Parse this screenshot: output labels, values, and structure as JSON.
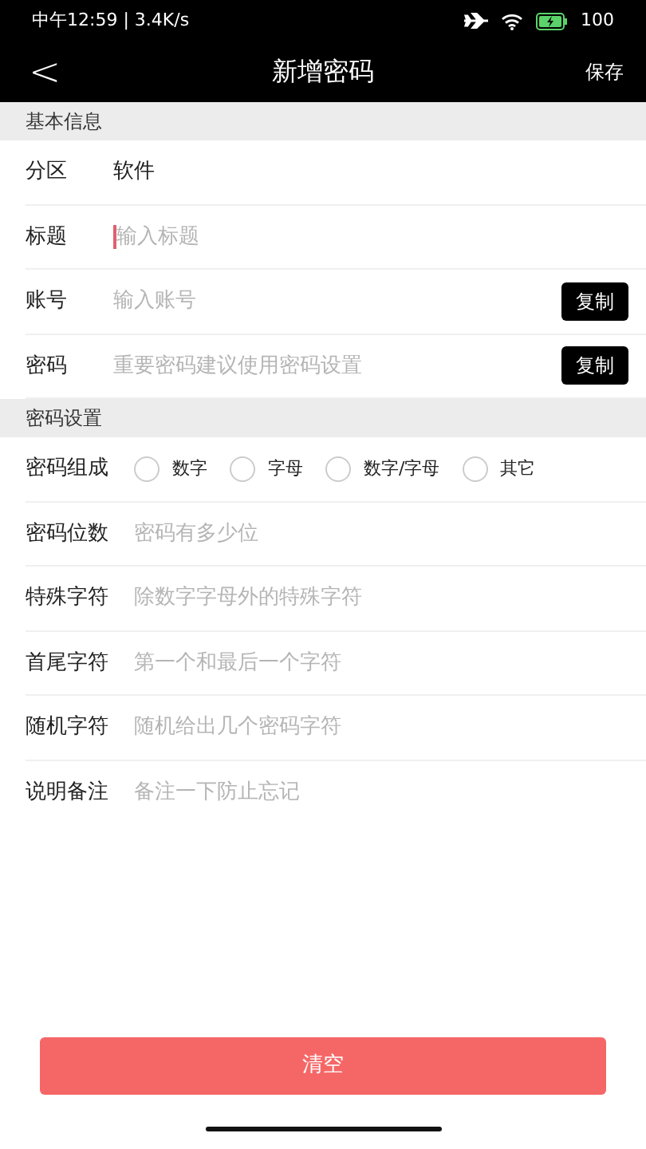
{
  "status_bar": {
    "time": "中午12:59 | 3.4K/s",
    "battery": "100"
  },
  "header": {
    "back": "<",
    "title": "新增密码",
    "action": "保存"
  },
  "sections": [
    {
      "title": "基本信息",
      "rows": [
        {
          "kind": "value",
          "label": "分区",
          "value": "软件"
        },
        {
          "kind": "input",
          "label": "标题",
          "placeholder": "输入标题",
          "focused": true
        },
        {
          "kind": "input",
          "label": "账号",
          "placeholder": "输入账号",
          "button": "复制",
          "focused": false
        },
        {
          "kind": "input",
          "label": "密码",
          "placeholder": "重要密码建议使用密码设置",
          "button": "复制",
          "focused": false
        }
      ]
    },
    {
      "title": "密码设置",
      "rows": [
        {
          "kind": "radio",
          "label": "密码组成",
          "options": [
            {
              "label": "数字",
              "selected": false
            },
            {
              "label": "字母",
              "selected": false
            },
            {
              "label": "数字/字母",
              "selected": false
            },
            {
              "label": "其它",
              "selected": false
            }
          ]
        },
        {
          "kind": "input",
          "label": "密码位数",
          "placeholder": "密码有多少位",
          "focused": false
        },
        {
          "kind": "input",
          "label": "特殊字符",
          "placeholder": "除数字字母外的特殊字符",
          "focused": false
        },
        {
          "kind": "input",
          "label": "首尾字符",
          "placeholder": "第一个和最后一个字符",
          "focused": false
        },
        {
          "kind": "input",
          "label": "随机字符",
          "placeholder": "随机给出几个密码字符",
          "focused": false
        },
        {
          "kind": "input",
          "label": "说明备注",
          "placeholder": "备注一下防止忘记",
          "focused": false
        }
      ]
    }
  ],
  "clear_button": "清空"
}
